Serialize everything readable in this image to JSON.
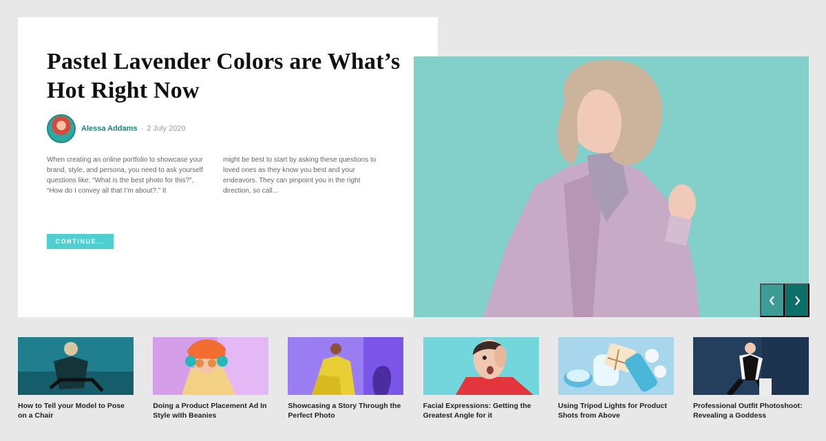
{
  "hero": {
    "title": "Pastel Lavender Colors are What’s Hot Right Now",
    "author": "Alessa Addams",
    "date": "2 July 2020",
    "excerpt_left": "When creating an online portfolio to showcase your brand, style, and persona, you need to ask yourself questions like: “What is the best photo for this?”, “How do I convey all that I’m about?.” It",
    "excerpt_right": "might be best to start by asking these questions to loved ones as they know you best and your endeavors. They can pinpoint you in the right direction, so call...",
    "button": "CONTINUE..."
  },
  "slider": {
    "prev_icon": "chevron-left-icon",
    "next_icon": "chevron-right-icon"
  },
  "thumbnails": [
    {
      "title": "How to Tell your Model to Pose on a Chair"
    },
    {
      "title": "Doing a Product Placement Ad In Style with Beanies"
    },
    {
      "title": "Showcasing a Story Through the Perfect Photo"
    },
    {
      "title": "Facial Expressions: Getting the Greatest Angle for it"
    },
    {
      "title": "Using Tripod Lights for Product Shots from Above"
    },
    {
      "title": "Professional Outfit Photoshoot: Revealing a Goddess"
    }
  ],
  "colors": {
    "accent": "#4fcfd0",
    "author": "#16857f",
    "slider_prev": "#3d9c96",
    "slider_next": "#0d6f69",
    "background": "#e8e8e8"
  }
}
